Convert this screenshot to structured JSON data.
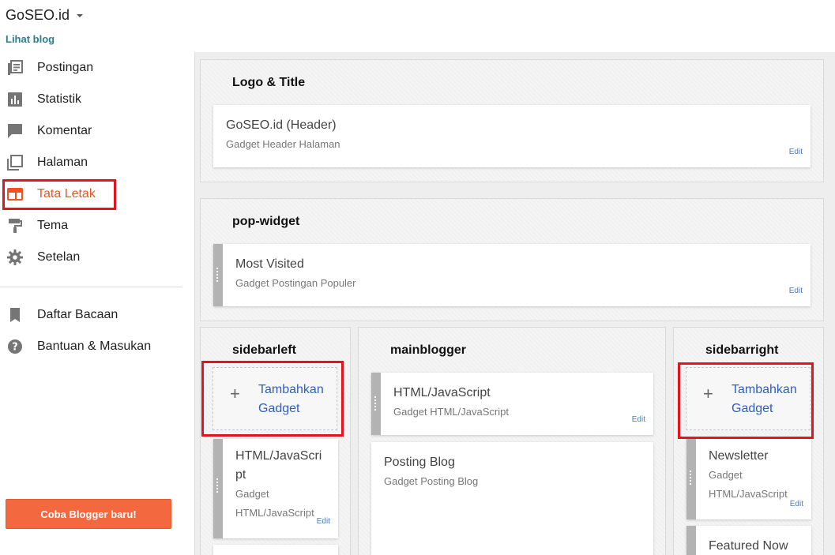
{
  "header": {
    "blog_name": "GoSEO.id",
    "view_blog": "Lihat blog"
  },
  "nav": {
    "items": [
      {
        "label": "Postingan"
      },
      {
        "label": "Statistik"
      },
      {
        "label": "Komentar"
      },
      {
        "label": "Halaman"
      },
      {
        "label": "Tata Letak"
      },
      {
        "label": "Tema"
      },
      {
        "label": "Setelan"
      }
    ],
    "secondary": [
      {
        "label": "Daftar Bacaan"
      },
      {
        "label": "Bantuan & Masukan"
      }
    ],
    "try_button": "Coba Blogger baru!"
  },
  "layout": {
    "logo_section": {
      "title": "Logo & Title",
      "gadget": {
        "title": "GoSEO.id (Header)",
        "subtitle": "Gadget Header Halaman",
        "edit": "Edit"
      }
    },
    "pop_section": {
      "title": "pop-widget",
      "gadget": {
        "title": "Most Visited",
        "subtitle": "Gadget Postingan Populer",
        "edit": "Edit"
      }
    },
    "sidebarleft": {
      "title": "sidebarleft",
      "add_line1": "Tambahkan",
      "add_line2": "Gadget",
      "gadget": {
        "title_line1": "HTML/JavaScri",
        "title_line2": "pt",
        "sub_line1": "Gadget",
        "sub_line2": "HTML/JavaScript",
        "edit": "Edit"
      }
    },
    "mainblogger": {
      "title": "mainblogger",
      "gadget1": {
        "title": "HTML/JavaScript",
        "subtitle": "Gadget HTML/JavaScript",
        "edit": "Edit"
      },
      "gadget2": {
        "title": "Posting Blog",
        "subtitle": "Gadget Posting Blog"
      }
    },
    "sidebarright": {
      "title": "sidebarright",
      "add_line1": "Tambahkan",
      "add_line2": "Gadget",
      "gadget1": {
        "title": "Newsletter",
        "sub_line1": "Gadget",
        "sub_line2": "HTML/JavaScript",
        "edit": "Edit"
      },
      "gadget2": {
        "title": "Featured Now"
      }
    }
  },
  "colors": {
    "accent": "#f4511e",
    "highlight": "#e3141d",
    "link": "#2f5ec4",
    "button": "#f4683f"
  }
}
